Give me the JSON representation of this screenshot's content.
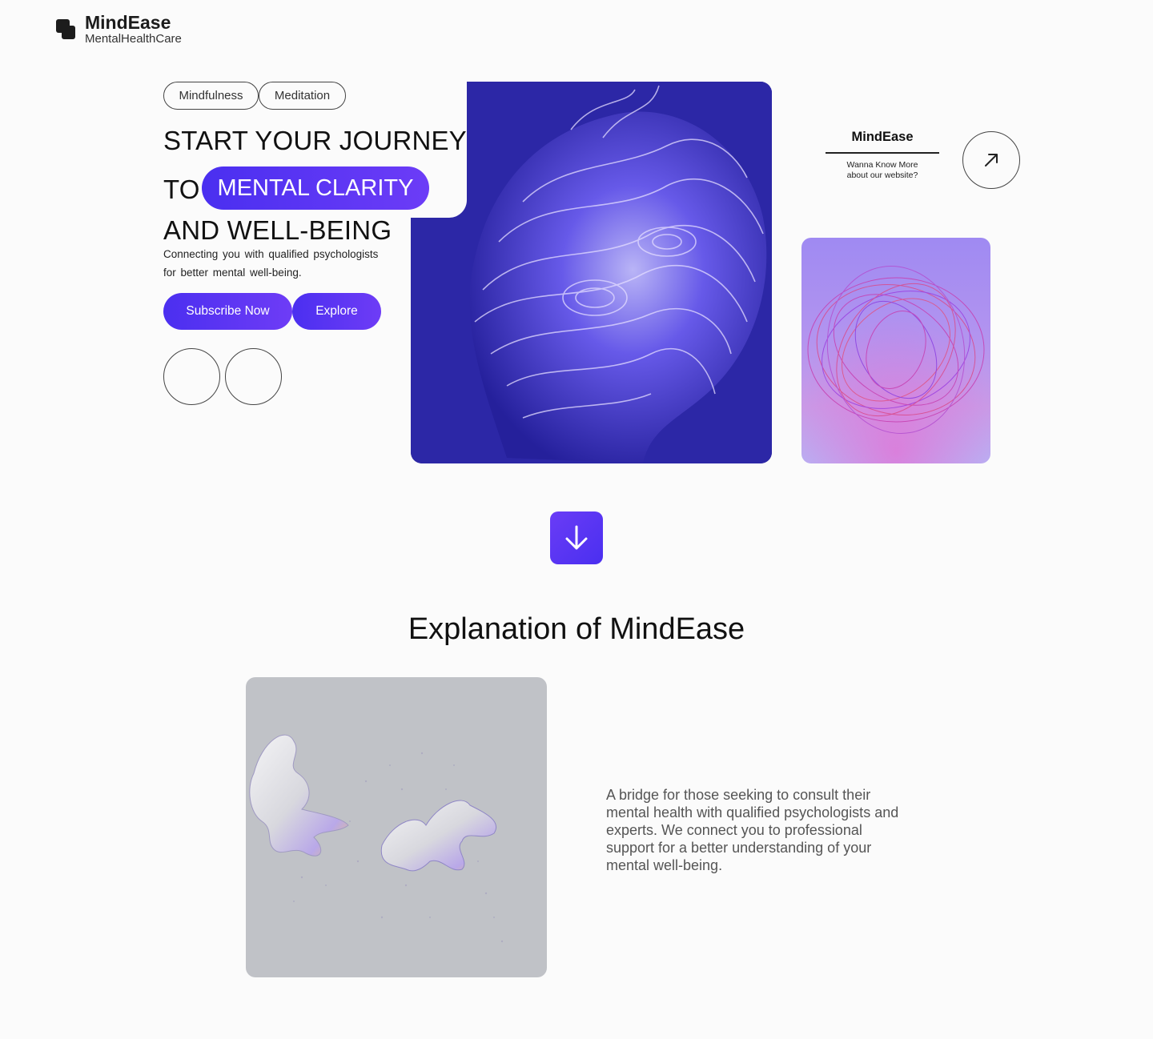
{
  "brand": {
    "name": "MindEase",
    "tagline": "MentalHealthCare"
  },
  "tags": [
    "Mindfulness",
    "Meditation"
  ],
  "hero": {
    "line1": "START YOUR JOURNEY",
    "line2_prefix": "TO",
    "highlight": "MENTAL CLARITY",
    "line3": "AND WELL-BEING",
    "description": "Connecting you with qualified psychologists for better mental well-being.",
    "primary_button": "Subscribe Now",
    "secondary_button": "Explore"
  },
  "side_card": {
    "title": "MindEase",
    "text": "Wanna Know More about our website?"
  },
  "explanation": {
    "title": "Explanation of MindEase",
    "text": "A bridge for those seeking to consult their mental health with qualified psychologists and experts. We connect you to professional support for a better understanding of your mental well-being."
  },
  "colors": {
    "accent": "#4a2ff0",
    "accent_light": "#6e3cf6",
    "background": "#fbfbfb"
  },
  "icons": {
    "arrow_up_right": "arrow-up-right-icon",
    "arrow_down": "arrow-down-icon",
    "logo": "logo-icon"
  }
}
